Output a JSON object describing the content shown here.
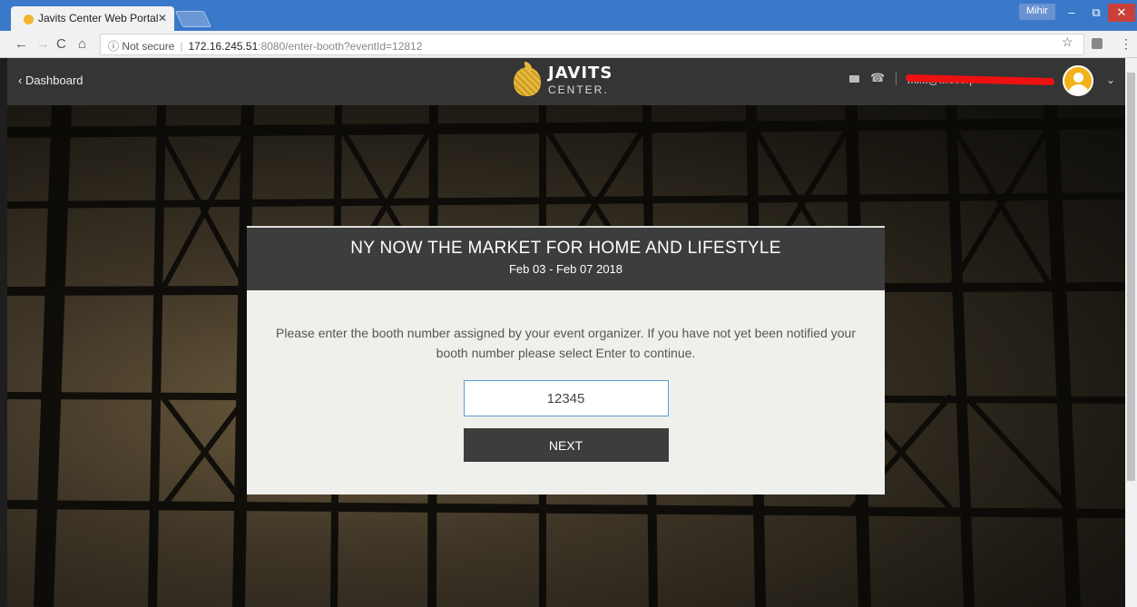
{
  "browser": {
    "tab_title": "Javits Center Web Portal",
    "tab_close": "✕",
    "user_badge": "Mihir",
    "win_min": "–",
    "win_max": "⧉",
    "win_close": "✕",
    "nav_back": "←",
    "nav_forward": "→",
    "nav_reload": "C",
    "nav_home": "⌂",
    "security_label": "ⓘ Not secure",
    "url_host": "172.16.245.51",
    "url_path": ":8080/enter-booth?eventId=12812",
    "star": "☆",
    "menu": "⋮"
  },
  "header": {
    "back_label": "‹  Dashboard",
    "logo_line1": "JAVITS",
    "logo_line2": "CENTER.",
    "phone_icon": "☎",
    "user_email": "mi...@...ecorp.com",
    "chevron": "⌄"
  },
  "modal": {
    "event_title": "NY NOW THE MARKET FOR HOME AND LIFESTYLE",
    "event_dates": "Feb 03 - Feb 07 2018",
    "message": "Please enter the booth number assigned by your event organizer. If you have not yet been notified your booth number please select Enter to continue.",
    "booth_value": "12345",
    "next_label": "NEXT"
  },
  "colors": {
    "accent": "#f3b21a",
    "header_bg": "#353535",
    "modal_head_bg": "#3d3d3d",
    "input_border": "#5b9bd5"
  }
}
